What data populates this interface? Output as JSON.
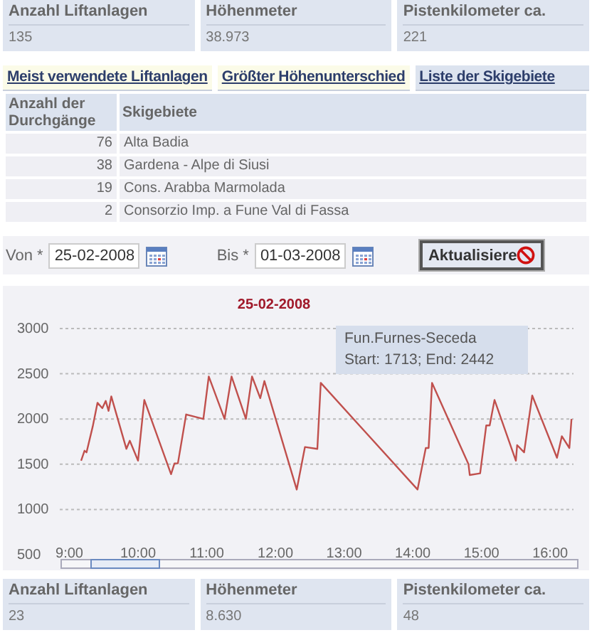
{
  "stats_top": [
    {
      "label": "Anzahl Liftanlagen",
      "value": "135"
    },
    {
      "label": "Höhenmeter",
      "value": "38.973"
    },
    {
      "label": "Pistenkilometer ca.",
      "value": "221"
    }
  ],
  "tabs": [
    {
      "label": "Meist verwendete Liftanlagen",
      "selected": false
    },
    {
      "label": "Größter Höhenunterschied",
      "selected": false
    },
    {
      "label": "Liste der Skigebiete",
      "selected": true
    }
  ],
  "table": {
    "columns": [
      "Anzahl der Durchgänge",
      "Skigebiete"
    ],
    "rows": [
      [
        "76",
        "Alta Badia"
      ],
      [
        "38",
        "Gardena - Alpe di Siusi"
      ],
      [
        "19",
        "Cons. Arabba Marmolada"
      ],
      [
        "2",
        "Consorzio Imp. a Fune Val di Fassa"
      ]
    ]
  },
  "filter": {
    "from_label": "Von *",
    "from_value": "25-02-2008",
    "to_label": "Bis *",
    "to_value": "01-03-2008",
    "button": "Aktualisiere"
  },
  "chart": {
    "tooltip": [
      "Fun.Furnes-Seceda",
      "Start: 1713; End: 2442"
    ],
    "chart_data": {
      "type": "line",
      "title": "25-02-2008",
      "grid": true,
      "xlim": [
        8.86,
        16.34
      ],
      "ylim": [
        500,
        3000
      ],
      "yticks": [
        500,
        1000,
        1500,
        2000,
        2500,
        3000
      ],
      "xticks": [
        {
          "value": 9,
          "label": "9:00"
        },
        {
          "value": 10,
          "label": "10:00"
        },
        {
          "value": 11,
          "label": "11:00"
        },
        {
          "value": 12,
          "label": "12:00"
        },
        {
          "value": 13,
          "label": "13:00"
        },
        {
          "value": 14,
          "label": "14:00"
        },
        {
          "value": 15,
          "label": "15:00"
        },
        {
          "value": 16,
          "label": "16:00"
        }
      ],
      "x": [
        9.17,
        9.22,
        9.25,
        9.34,
        9.41,
        9.48,
        9.53,
        9.57,
        9.61,
        9.83,
        9.88,
        10.0,
        10.09,
        10.48,
        10.53,
        10.58,
        10.7,
        10.95,
        11.03,
        11.26,
        11.36,
        11.57,
        11.66,
        11.78,
        11.84,
        12.31,
        12.43,
        12.61,
        12.66,
        14.07,
        14.19,
        14.23,
        14.28,
        14.81,
        14.83,
        14.98,
        15.07,
        15.12,
        15.19,
        15.5,
        15.52,
        15.62,
        15.74,
        16.1,
        16.17,
        16.28,
        16.31
      ],
      "series": [
        {
          "color": "#c0504d",
          "values": [
            1540,
            1650,
            1630,
            1920,
            2180,
            2120,
            2200,
            2090,
            2250,
            1670,
            1760,
            1540,
            2210,
            1390,
            1510,
            1510,
            2050,
            2000,
            2470,
            2000,
            2470,
            2000,
            2470,
            2230,
            2420,
            1220,
            1690,
            1670,
            2400,
            1220,
            1680,
            1680,
            2400,
            1500,
            1380,
            1400,
            1930,
            1930,
            2210,
            1540,
            1710,
            1630,
            2260,
            1570,
            1810,
            1680,
            2000
          ]
        }
      ]
    }
  },
  "stats_bottom": [
    {
      "label": "Anzahl Liftanlagen",
      "value": "23"
    },
    {
      "label": "Höhenmeter",
      "value": "8.630"
    },
    {
      "label": "Pistenkilometer ca.",
      "value": "48"
    }
  ]
}
